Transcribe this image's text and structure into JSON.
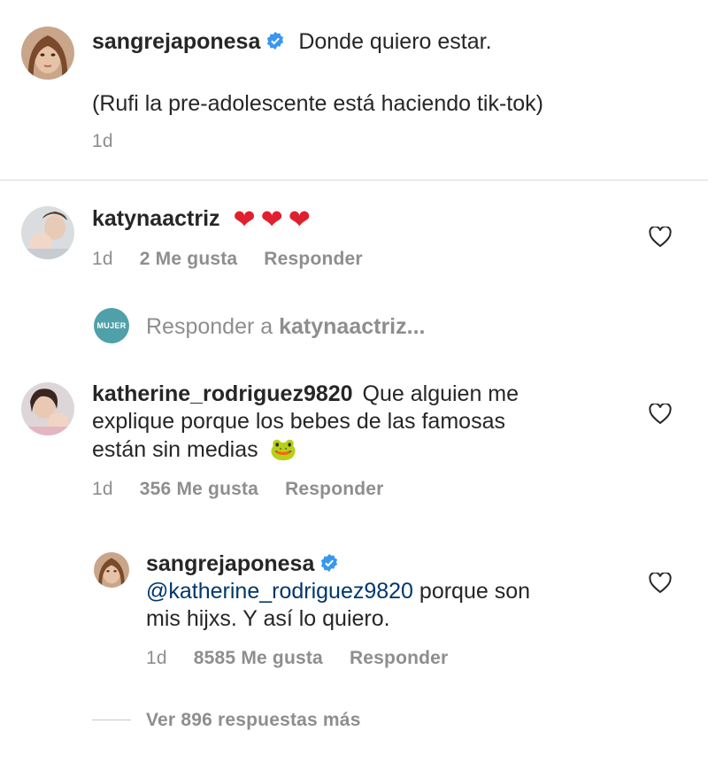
{
  "caption": {
    "username": "sangrejaponesa",
    "text_line1": "Donde quiero estar.",
    "text_line2": "(Rufi la pre-adolescente está haciendo tik-tok)",
    "time": "1d"
  },
  "comments": [
    {
      "username": "katynaactriz",
      "hearts": "❤❤❤",
      "time": "1d",
      "likes": "2 Me gusta",
      "reply": "Responder"
    },
    {
      "username": "katherine_rodriguez9820",
      "text_line1": "Que alguien me",
      "text_line2": "explique porque los bebes de las famosas",
      "text_line3": "están sin medias",
      "emoji": "🐸",
      "time": "1d",
      "likes": "356 Me gusta",
      "reply": "Responder"
    }
  ],
  "reply_box": {
    "avatar_text": "MUJER",
    "prefix": "Responder a",
    "target": "katynaactriz..."
  },
  "nested_reply": {
    "username": "sangrejaponesa",
    "mention": "@katherine_rodriguez9820",
    "text_line1_rest": " porque son",
    "text_line2": "mis hijxs. Y así lo quiero.",
    "time": "1d",
    "likes": "8585 Me gusta",
    "reply": "Responder"
  },
  "view_more": "Ver 896 respuestas más",
  "colors": {
    "text": "#262626",
    "secondary": "#8e8e8e",
    "verified": "#3897f0",
    "mention": "#00376b",
    "divider": "#dbdbdb"
  }
}
